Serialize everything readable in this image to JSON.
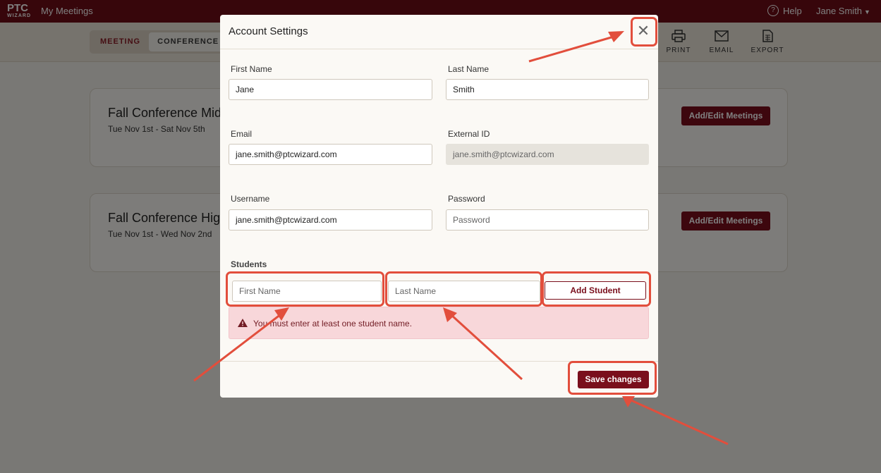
{
  "topbar": {
    "logo_text": "PTC",
    "logo_sub": "WIZARD",
    "app_title": "My Meetings",
    "help_label": "Help",
    "user_name": "Jane Smith"
  },
  "subbar": {
    "segments": [
      {
        "label": "MEETING",
        "active": false
      },
      {
        "label": "CONFERENCE",
        "active": true
      }
    ],
    "tools": [
      {
        "label": "PRINT",
        "icon": "printer-icon"
      },
      {
        "label": "EMAIL",
        "icon": "envelope-icon"
      },
      {
        "label": "EXPORT",
        "icon": "spreadsheet-icon"
      }
    ]
  },
  "cards": [
    {
      "title": "Fall Conference Midd",
      "dates": "Tue Nov 1st - Sat Nov 5th",
      "button": "Add/Edit Meetings"
    },
    {
      "title": "Fall Conference High",
      "dates": "Tue Nov 1st - Wed Nov 2nd",
      "button": "Add/Edit Meetings"
    }
  ],
  "modal": {
    "title": "Account Settings",
    "close_icon": "close-icon",
    "fields": {
      "first_name_label": "First Name",
      "first_name_value": "Jane",
      "last_name_label": "Last Name",
      "last_name_value": "Smith",
      "email_label": "Email",
      "email_value": "jane.smith@ptcwizard.com",
      "external_id_label": "External ID",
      "external_id_value": "jane.smith@ptcwizard.com",
      "username_label": "Username",
      "username_value": "jane.smith@ptcwizard.com",
      "password_label": "Password",
      "password_placeholder": "Password"
    },
    "students": {
      "label": "Students",
      "first_name_placeholder": "First Name",
      "last_name_placeholder": "Last Name",
      "add_button": "Add Student"
    },
    "alert": {
      "icon": "warning-triangle-icon",
      "text": "You must enter at least one student name."
    },
    "save_button": "Save changes"
  },
  "colors": {
    "brand": "#6e0d17",
    "button": "#7a0f1c",
    "annotation": "#e24e3c",
    "alert_bg": "#f8d7da"
  }
}
